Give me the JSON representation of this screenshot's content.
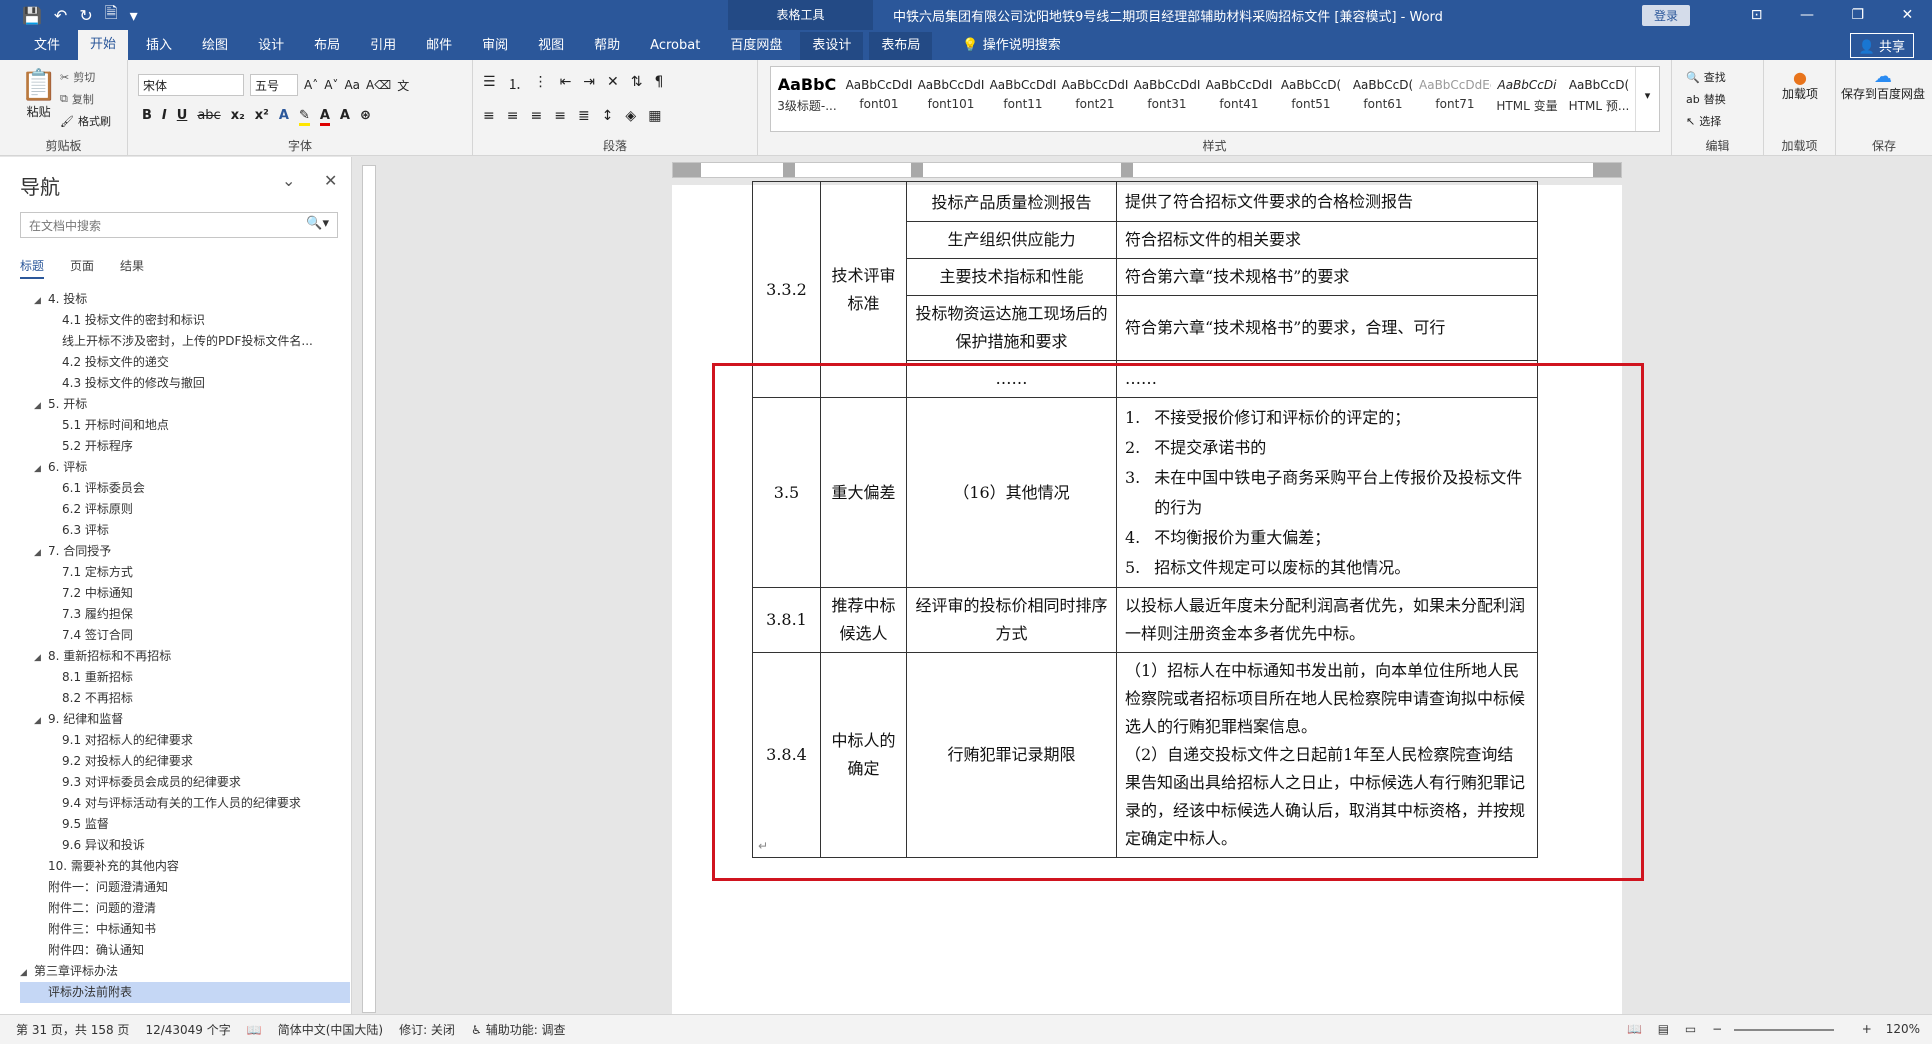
{
  "window": {
    "context_tools": "表格工具",
    "title": "中铁六局集团有限公司沈阳地铁9号线二期项目经理部辅助材料采购招标文件 [兼容模式] - Word",
    "login": "登录",
    "share": "共享"
  },
  "ribbon_tabs": [
    "文件",
    "开始",
    "插入",
    "绘图",
    "设计",
    "布局",
    "引用",
    "邮件",
    "审阅",
    "视图",
    "帮助",
    "Acrobat",
    "百度网盘",
    "表设计",
    "表布局"
  ],
  "tell_me": "操作说明搜索",
  "clipboard": {
    "paste": "粘贴",
    "cut": "剪切",
    "copy": "复制",
    "format_painter": "格式刷",
    "label": "剪贴板"
  },
  "font": {
    "name": "宋体",
    "size": "五号",
    "label": "字体"
  },
  "paragraph": {
    "label": "段落"
  },
  "styles": {
    "label": "样式",
    "items": [
      {
        "preview": "AaBbC",
        "name": "3级标题-..."
      },
      {
        "preview": "AaBbCcDdI",
        "name": "font01"
      },
      {
        "preview": "AaBbCcDdI",
        "name": "font101"
      },
      {
        "preview": "AaBbCcDdI",
        "name": "font11"
      },
      {
        "preview": "AaBbCcDdI",
        "name": "font21"
      },
      {
        "preview": "AaBbCcDdI",
        "name": "font31"
      },
      {
        "preview": "AaBbCcDdI",
        "name": "font41"
      },
      {
        "preview": "AaBbCcD(",
        "name": "font51"
      },
      {
        "preview": "AaBbCcD(",
        "name": "font61"
      },
      {
        "preview": "AaBbCcDdEe",
        "name": "font71"
      },
      {
        "preview": "AaBbCcDi",
        "name": "HTML 变量"
      },
      {
        "preview": "AaBbCcD(",
        "name": "HTML 预..."
      }
    ]
  },
  "editing": {
    "find": "查找",
    "replace": "替换",
    "select": "选择",
    "label": "编辑"
  },
  "addins": {
    "btn": "加载项",
    "label": "加载项"
  },
  "save_group": {
    "btn": "保存到百度网盘",
    "label": "保存"
  },
  "nav": {
    "title": "导航",
    "search_placeholder": "在文档中搜索",
    "tabs": [
      "标题",
      "页面",
      "结果"
    ],
    "items": [
      {
        "text": "4. 投标",
        "level": 1,
        "tri": true
      },
      {
        "text": "4.1 投标文件的密封和标识",
        "level": 2
      },
      {
        "text": "线上开标不涉及密封，上传的PDF投标文件名...",
        "level": 2
      },
      {
        "text": "4.2 投标文件的递交",
        "level": 2
      },
      {
        "text": "4.3 投标文件的修改与撤回",
        "level": 2
      },
      {
        "text": "5. 开标",
        "level": 1,
        "tri": true
      },
      {
        "text": "5.1 开标时间和地点",
        "level": 2
      },
      {
        "text": "5.2 开标程序",
        "level": 2
      },
      {
        "text": "6. 评标",
        "level": 1,
        "tri": true
      },
      {
        "text": "6.1 评标委员会",
        "level": 2
      },
      {
        "text": "6.2 评标原则",
        "level": 2
      },
      {
        "text": "6.3 评标",
        "level": 2
      },
      {
        "text": "7. 合同授予",
        "level": 1,
        "tri": true
      },
      {
        "text": "7.1 定标方式",
        "level": 2
      },
      {
        "text": "7.2 中标通知",
        "level": 2
      },
      {
        "text": "7.3 履约担保",
        "level": 2
      },
      {
        "text": "7.4 签订合同",
        "level": 2
      },
      {
        "text": "8. 重新招标和不再招标",
        "level": 1,
        "tri": true
      },
      {
        "text": "8.1 重新招标",
        "level": 2
      },
      {
        "text": "8.2 不再招标",
        "level": 2
      },
      {
        "text": "9. 纪律和监督",
        "level": 1,
        "tri": true
      },
      {
        "text": "9.1 对招标人的纪律要求",
        "level": 2
      },
      {
        "text": "9.2 对投标人的纪律要求",
        "level": 2
      },
      {
        "text": "9.3 对评标委员会成员的纪律要求",
        "level": 2
      },
      {
        "text": "9.4 对与评标活动有关的工作人员的纪律要求",
        "level": 2
      },
      {
        "text": "9.5 监督",
        "level": 2
      },
      {
        "text": "9.6 异议和投诉",
        "level": 2
      },
      {
        "text": "10. 需要补充的其他内容",
        "level": 1
      },
      {
        "text": "附件一：问题澄清通知",
        "level": 1
      },
      {
        "text": "附件二：问题的澄清",
        "level": 1
      },
      {
        "text": "附件三：中标通知书",
        "level": 1
      },
      {
        "text": "附件四：确认通知",
        "level": 1
      },
      {
        "text": "第三章评标办法",
        "level": 0,
        "tri": true
      },
      {
        "text": "评标办法前附表",
        "level": 1,
        "selected": true
      }
    ]
  },
  "table": {
    "r0_c2": "投标产品质量检测报告",
    "r0_c3": "提供了符合招标文件要求的合格检测报告",
    "g1_num": "3.3.2",
    "g1_name": "技术评审标准",
    "r1_c2": "生产组织供应能力",
    "r1_c3": "符合招标文件的相关要求",
    "r2_c2": "主要技术指标和性能",
    "r2_c3": "符合第六章“技术规格书”的要求",
    "r3_c2": "投标物资运达施工现场后的保护措施和要求",
    "r3_c3": "符合第六章“技术规格书”的要求，合理、可行",
    "r4_c2": "……",
    "r4_c3": "……",
    "g2_num": "3.5",
    "g2_name": "重大偏差",
    "g2_c2": "（16）其他情况",
    "g2_list": [
      {
        "n": "1.",
        "t": "不接受报价修订和评标价的评定的；"
      },
      {
        "n": "2.",
        "t": "不提交承诺书的"
      },
      {
        "n": "3.",
        "t": "未在中国中铁电子商务采购平台上传报价及投标文件的行为"
      },
      {
        "n": "4.",
        "t": "不均衡报价为重大偏差；"
      },
      {
        "n": "5.",
        "t": "招标文件规定可以废标的其他情况。"
      }
    ],
    "g3_num": "3.8.1",
    "g3_name": "推荐中标候选人",
    "g3_c2": "经评审的投标价相同时排序方式",
    "g3_c3": "以投标人最近年度未分配利润高者优先，如果未分配利润一样则注册资金本多者优先中标。",
    "g4_num": "3.8.4",
    "g4_name": "中标人的确定",
    "g4_c2": "行贿犯罪记录期限",
    "g4_p1": "（1）招标人在中标通知书发出前，向本单位住所地人民检察院或者招标项目所在地人民检察院申请查询拟中标候选人的行贿犯罪档案信息。",
    "g4_p2": "（2）自递交投标文件之日起前1年至人民检察院查询结果告知函出具给招标人之日止，中标候选人有行贿犯罪记录的，经该中标候选人确认后，取消其中标资格，并按规定确定中标人。"
  },
  "status": {
    "page": "第 31 页，共 158 页",
    "words": "12/43049 个字",
    "lang": "简体中文(中国大陆)",
    "track": "修订: 关闭",
    "access": "辅助功能: 调查",
    "zoom": "120%"
  },
  "colors": {
    "brand": "#2b579a",
    "highlight_box": "#d0141f"
  }
}
